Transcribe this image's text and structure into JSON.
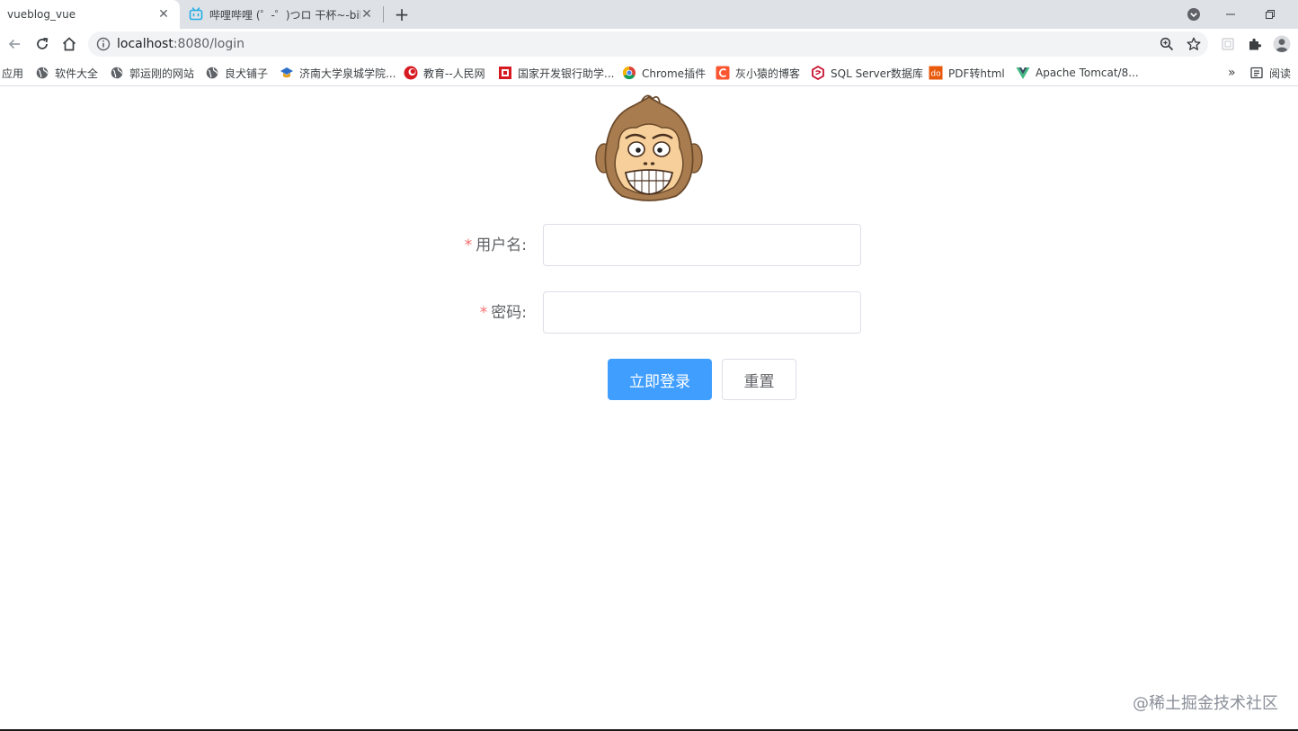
{
  "browser": {
    "tabs": [
      {
        "title": "vueblog_vue",
        "active": true
      },
      {
        "title": "哔哩哔哩 (゜-゜)つロ 干杯~-bilibili",
        "active": false
      }
    ],
    "url": {
      "host": "localhost",
      "path": ":8080/login"
    },
    "bookmarks": [
      {
        "label": "应用",
        "icon": "apps-icon"
      },
      {
        "label": "软件大全",
        "icon": "globe-icon"
      },
      {
        "label": "郭运刚的网站",
        "icon": "globe-icon"
      },
      {
        "label": "良犬铺子",
        "icon": "globe-icon"
      },
      {
        "label": "济南大学泉城学院...",
        "icon": "school-icon"
      },
      {
        "label": "教育--人民网",
        "icon": "people-icon"
      },
      {
        "label": "国家开发银行助学...",
        "icon": "bank-icon"
      },
      {
        "label": "Chrome插件",
        "icon": "chrome-icon"
      },
      {
        "label": "灰小猿的博客",
        "icon": "csdn-icon"
      },
      {
        "label": "SQL Server数据库",
        "icon": "sql-icon"
      },
      {
        "label": "PDF转html",
        "icon": "pdf-icon"
      },
      {
        "label": "Apache Tomcat/8...",
        "icon": "vue-icon"
      },
      {
        "label": "阅读",
        "icon": "reading-list-icon"
      }
    ],
    "colors": {
      "tabstrip": "#dee1e6",
      "bilibili": "#23ade5"
    }
  },
  "login": {
    "username_label": "用户名:",
    "password_label": "密码:",
    "required_mark": "*",
    "username_value": "",
    "password_value": "",
    "submit_label": "立即登录",
    "reset_label": "重置",
    "colors": {
      "primary": "#409eff",
      "required": "#f56c6c"
    }
  },
  "watermark": "@稀土掘金技术社区"
}
